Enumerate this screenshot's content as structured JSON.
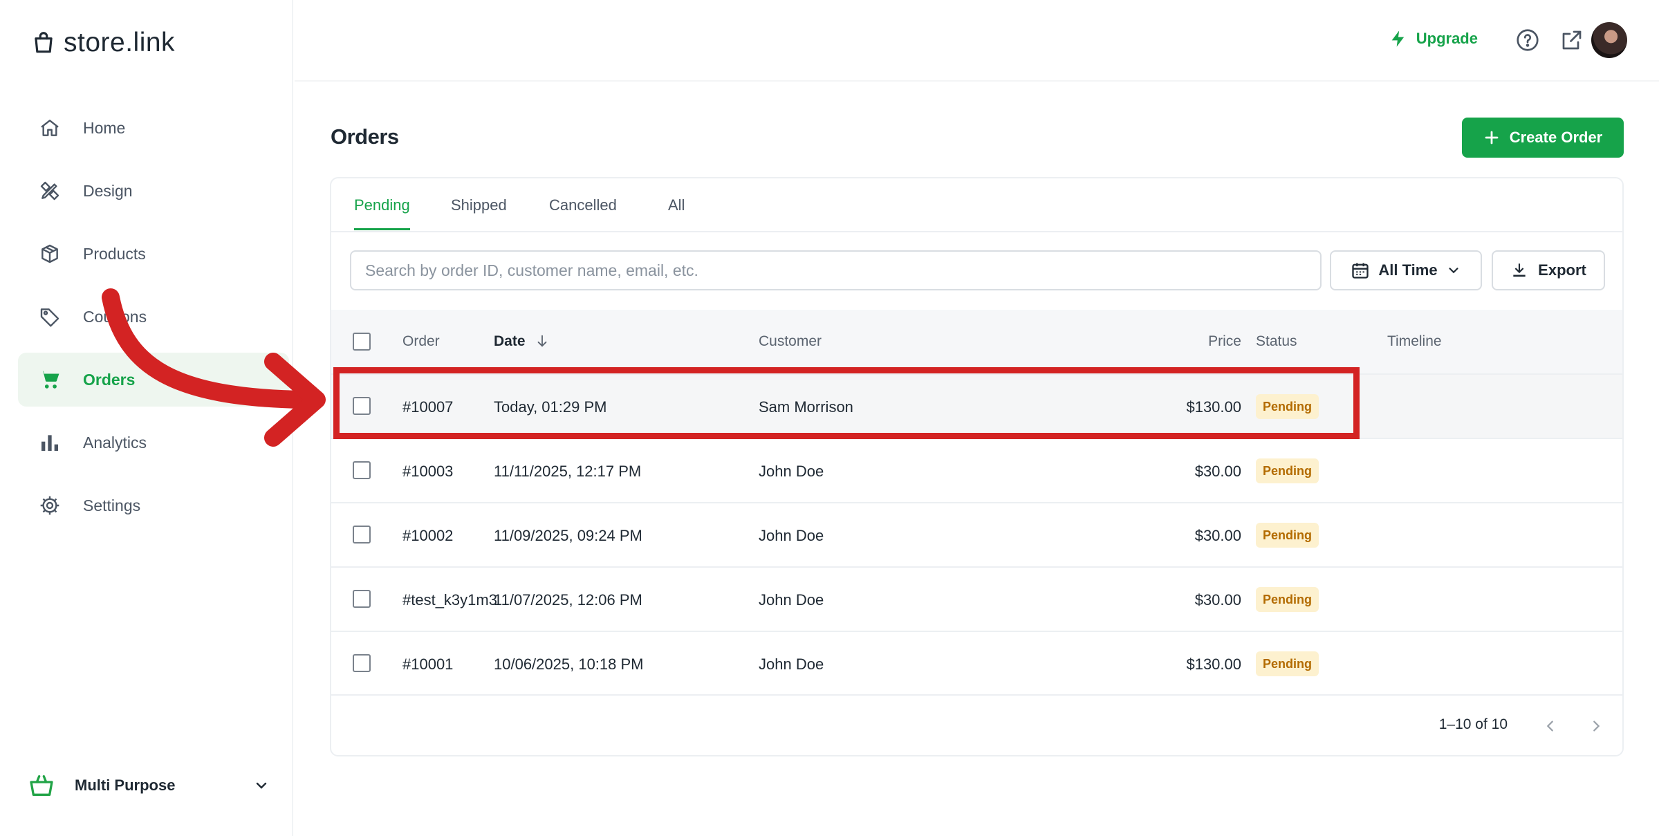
{
  "app": {
    "logo_text": "store.link"
  },
  "sidebar": {
    "items": [
      {
        "label": "Home",
        "icon": "home-icon",
        "active": false
      },
      {
        "label": "Design",
        "icon": "design-tools-icon",
        "active": false
      },
      {
        "label": "Products",
        "icon": "box-icon",
        "active": false
      },
      {
        "label": "Coupons",
        "icon": "tag-icon",
        "active": false
      },
      {
        "label": "Orders",
        "icon": "cart-icon",
        "active": true
      },
      {
        "label": "Analytics",
        "icon": "bar-chart-icon",
        "active": false
      },
      {
        "label": "Settings",
        "icon": "gear-icon",
        "active": false
      }
    ],
    "store": {
      "name": "Multi Purpose",
      "icon": "shopping-bag-icon"
    }
  },
  "topbar": {
    "upgrade_label": "Upgrade",
    "icons": [
      "lightning-icon",
      "help-circle-icon",
      "external-link-icon",
      "avatar"
    ]
  },
  "main": {
    "title": "Orders",
    "create_button": "Create Order",
    "tabs": [
      {
        "label": "Pending",
        "active": true
      },
      {
        "label": "Shipped",
        "active": false
      },
      {
        "label": "Cancelled",
        "active": false
      },
      {
        "label": "All",
        "active": false
      }
    ],
    "search": {
      "placeholder": "Search by order ID, customer name, email, etc.",
      "value": ""
    },
    "date_filter": "All Time",
    "export_label": "Export",
    "table": {
      "columns": [
        "Order",
        "Date",
        "Customer",
        "Price",
        "Status",
        "Timeline"
      ],
      "sort_column": "Date",
      "rows": [
        {
          "order": "#10007",
          "date": "Today, 01:29 PM",
          "customer": "Sam Morrison",
          "price": "$130.00",
          "status": "Pending",
          "highlighted": true
        },
        {
          "order": "#10003",
          "date": "11/11/2025, 12:17 PM",
          "customer": "John Doe",
          "price": "$30.00",
          "status": "Pending"
        },
        {
          "order": "#10002",
          "date": "11/09/2025, 09:24 PM",
          "customer": "John Doe",
          "price": "$30.00",
          "status": "Pending"
        },
        {
          "order": "#test_k3y1m3",
          "date": "11/07/2025, 12:06 PM",
          "customer": "John Doe",
          "price": "$30.00",
          "status": "Pending"
        },
        {
          "order": "#10001",
          "date": "10/06/2025, 10:18 PM",
          "customer": "John Doe",
          "price": "$130.00",
          "status": "Pending"
        }
      ]
    },
    "pagination": {
      "range_text": "1–10 of 10"
    }
  },
  "colors": {
    "accent": "#16a34a",
    "annotation": "#d32323",
    "badge_bg": "#fdf1cf",
    "badge_text": "#b36b00"
  }
}
